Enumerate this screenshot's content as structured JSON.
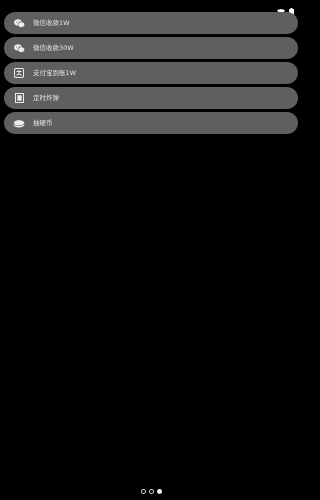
{
  "status_bar": {
    "icons": [
      "wifi-icon",
      "battery-icon"
    ]
  },
  "menu": {
    "items": [
      {
        "label": "微信收款1W",
        "icon": "wechat-icon"
      },
      {
        "label": "微信收款30W",
        "icon": "wechat-icon"
      },
      {
        "label": "支付宝到账1W",
        "icon": "alipay-icon"
      },
      {
        "label": "定时炸弹",
        "icon": "timer-bomb-icon"
      },
      {
        "label": "抽硬币",
        "icon": "coin-icon"
      }
    ]
  },
  "pager": {
    "count": 3,
    "active_index": 2
  },
  "colors": {
    "background": "#000000",
    "item_bg": "#5f5f5f",
    "text": "#e6e6e6"
  }
}
